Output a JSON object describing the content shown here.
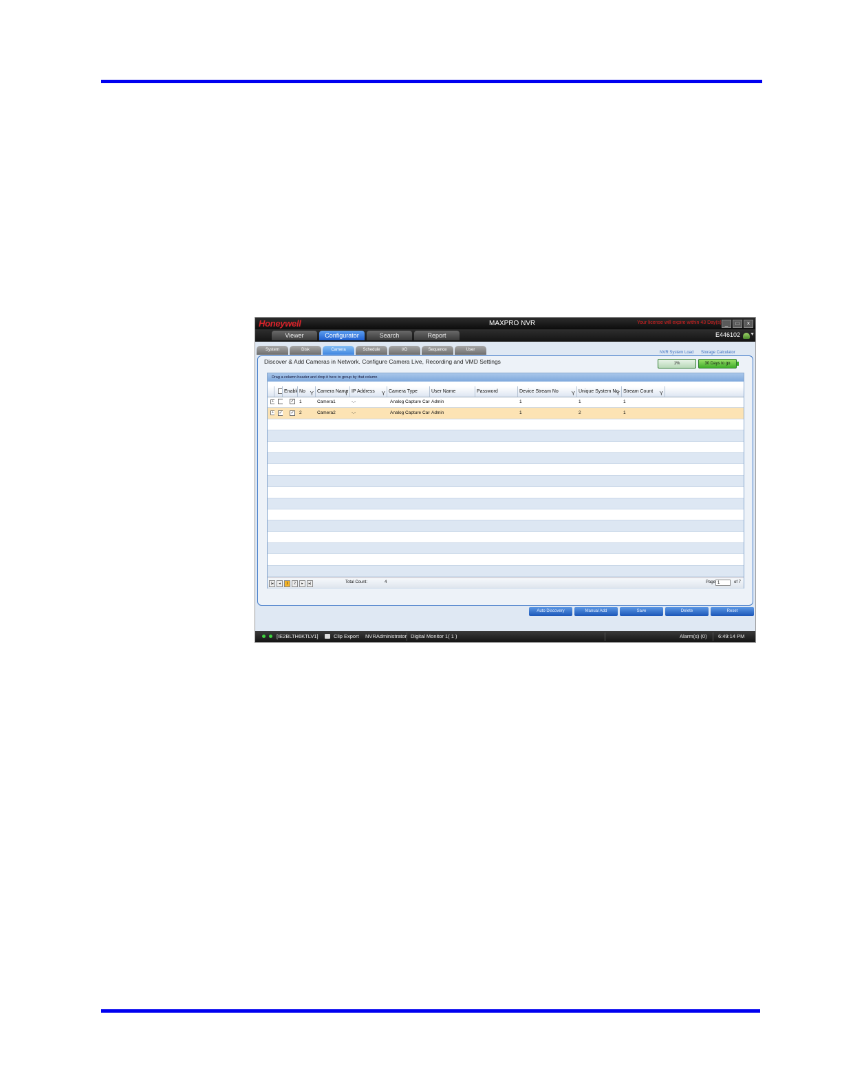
{
  "window": {
    "logo": "Honeywell",
    "title": "MAXPRO NVR",
    "license_notice": "Your license will expire within 43 Day(s)",
    "controls": [
      "minimize-icon",
      "maximize-icon",
      "close-icon"
    ]
  },
  "nav": {
    "tabs": [
      {
        "label": "Viewer",
        "active": false
      },
      {
        "label": "Configurator",
        "active": true
      },
      {
        "label": "Search",
        "active": false
      },
      {
        "label": "Report",
        "active": false
      }
    ],
    "user": "E446102",
    "user_icon": "users-icon"
  },
  "subtabs": [
    {
      "label": "System",
      "active": false
    },
    {
      "label": "Disk",
      "active": false
    },
    {
      "label": "Camera",
      "active": true
    },
    {
      "label": "Schedule",
      "active": false
    },
    {
      "label": "I/O",
      "active": false
    },
    {
      "label": "Sequence",
      "active": false
    },
    {
      "label": "User",
      "active": false
    }
  ],
  "panel": {
    "instruction": "Discover & Add Cameras in Network. Configure Camera Live, Recording and VMD Settings",
    "nvr_load_label": "NVR System Load",
    "nvr_load_value": "1%",
    "storage_label": "Storage Calculator",
    "storage_value": "30 Days to go"
  },
  "grid": {
    "group_hint": "Drag a column header and drop it here to group by that column",
    "columns": [
      "Enable",
      "No",
      "Camera Name",
      "IP Address",
      "Camera Type",
      "User Name",
      "Password",
      "Device Stream No",
      "Unique System No",
      "Stream Count"
    ],
    "rows": [
      {
        "selected": false,
        "enable": true,
        "no": "1",
        "camera_name": "Camera1",
        "ip": "-.-",
        "type": "Analog Capture Card",
        "user": "Admin",
        "password": "",
        "device_stream": "1",
        "unique_system": "1",
        "stream_count": "1"
      },
      {
        "selected": true,
        "enable": true,
        "no": "2",
        "camera_name": "Camera2",
        "ip": "-.-",
        "type": "Analog Capture Card",
        "user": "Admin",
        "password": "",
        "device_stream": "1",
        "unique_system": "2",
        "stream_count": "1"
      }
    ],
    "pager": {
      "pages": [
        "1",
        "2"
      ],
      "current": "1",
      "total_label": "Total Count:",
      "total_value": "4",
      "page_label": "Page",
      "page_input": "1",
      "page_of": "of 7"
    }
  },
  "actions": [
    "Auto Discovery",
    "Manual Add",
    "Save",
    "Delete",
    "Reset"
  ],
  "statusbar": {
    "host": "[IE2BLTH6KTLV1]",
    "clip_export": "Clip Export",
    "user": "NVRAdministrator",
    "monitor": "Digital Monitor 1( 1 )",
    "alarms": "Alarm(s) (0)",
    "time": "6:49:14 PM"
  }
}
